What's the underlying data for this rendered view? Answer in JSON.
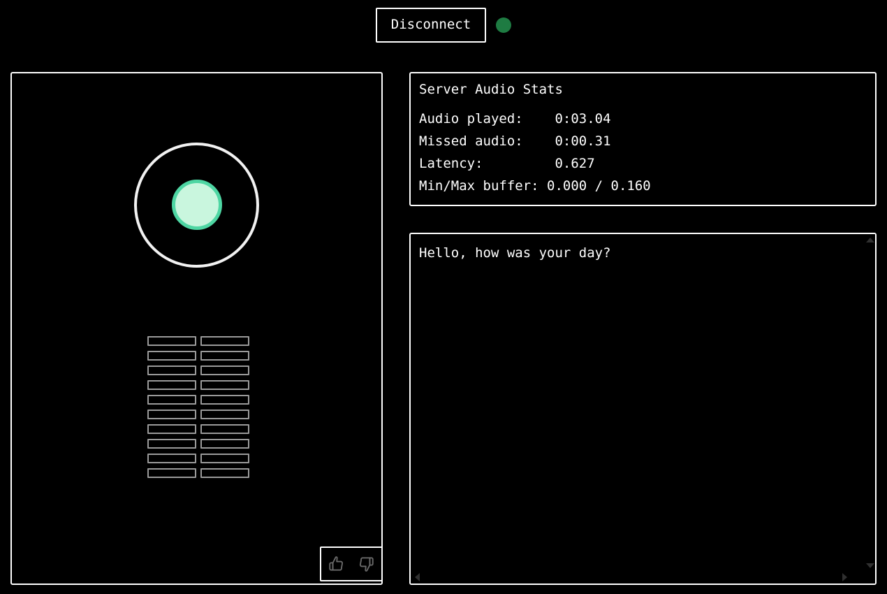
{
  "theme": {
    "background": "#000000",
    "foreground": "#ffffff",
    "border": "#ffffff",
    "status_dot": "#1e7b42",
    "orb_ring": "#f2f2f2",
    "orb_core_fill": "#c9f6de",
    "orb_core_ring": "#4ed6a3",
    "meter_border": "#9a9a9a",
    "scrollbar_arrow": "#303030",
    "feedback_icon": "#6b6b6b"
  },
  "topbar": {
    "disconnect_label": "Disconnect",
    "status_dot_name": "connected-status-dot"
  },
  "visualizer": {
    "orb_outer_name": "audio-orb-ring",
    "orb_inner_name": "audio-orb-core",
    "meter": {
      "columns": 2,
      "rows": 10,
      "cells": [
        "bar-1-left",
        "bar-1-right",
        "bar-2-left",
        "bar-2-right",
        "bar-3-left",
        "bar-3-right",
        "bar-4-left",
        "bar-4-right",
        "bar-5-left",
        "bar-5-right",
        "bar-6-left",
        "bar-6-right",
        "bar-7-left",
        "bar-7-right",
        "bar-8-left",
        "bar-8-right",
        "bar-9-left",
        "bar-9-right",
        "bar-10-left",
        "bar-10-right"
      ]
    },
    "feedback": {
      "thumbs_up_name": "thumbs-up-icon",
      "thumbs_down_name": "thumbs-down-icon"
    }
  },
  "stats": {
    "title": "Server Audio Stats",
    "rows": [
      {
        "label": "Audio played:",
        "value": "0:03.04",
        "line": "Audio played:    0:03.04"
      },
      {
        "label": "Missed audio:",
        "value": "0:00.31",
        "line": "Missed audio:    0:00.31"
      },
      {
        "label": "Latency:",
        "value": "0.627",
        "line": "Latency:         0.627"
      },
      {
        "label": "Min/Max buffer:",
        "value": "0.000 / 0.160",
        "line": "Min/Max buffer: 0.000 / 0.160"
      }
    ]
  },
  "transcript": {
    "value": "Hello, how was your day?",
    "placeholder": "",
    "scrollbars": {
      "up_arrow": "scrollbar-up-arrow",
      "down_arrow": "scrollbar-down-arrow",
      "left_arrow": "scrollbar-left-arrow",
      "right_arrow": "scrollbar-right-arrow"
    }
  }
}
